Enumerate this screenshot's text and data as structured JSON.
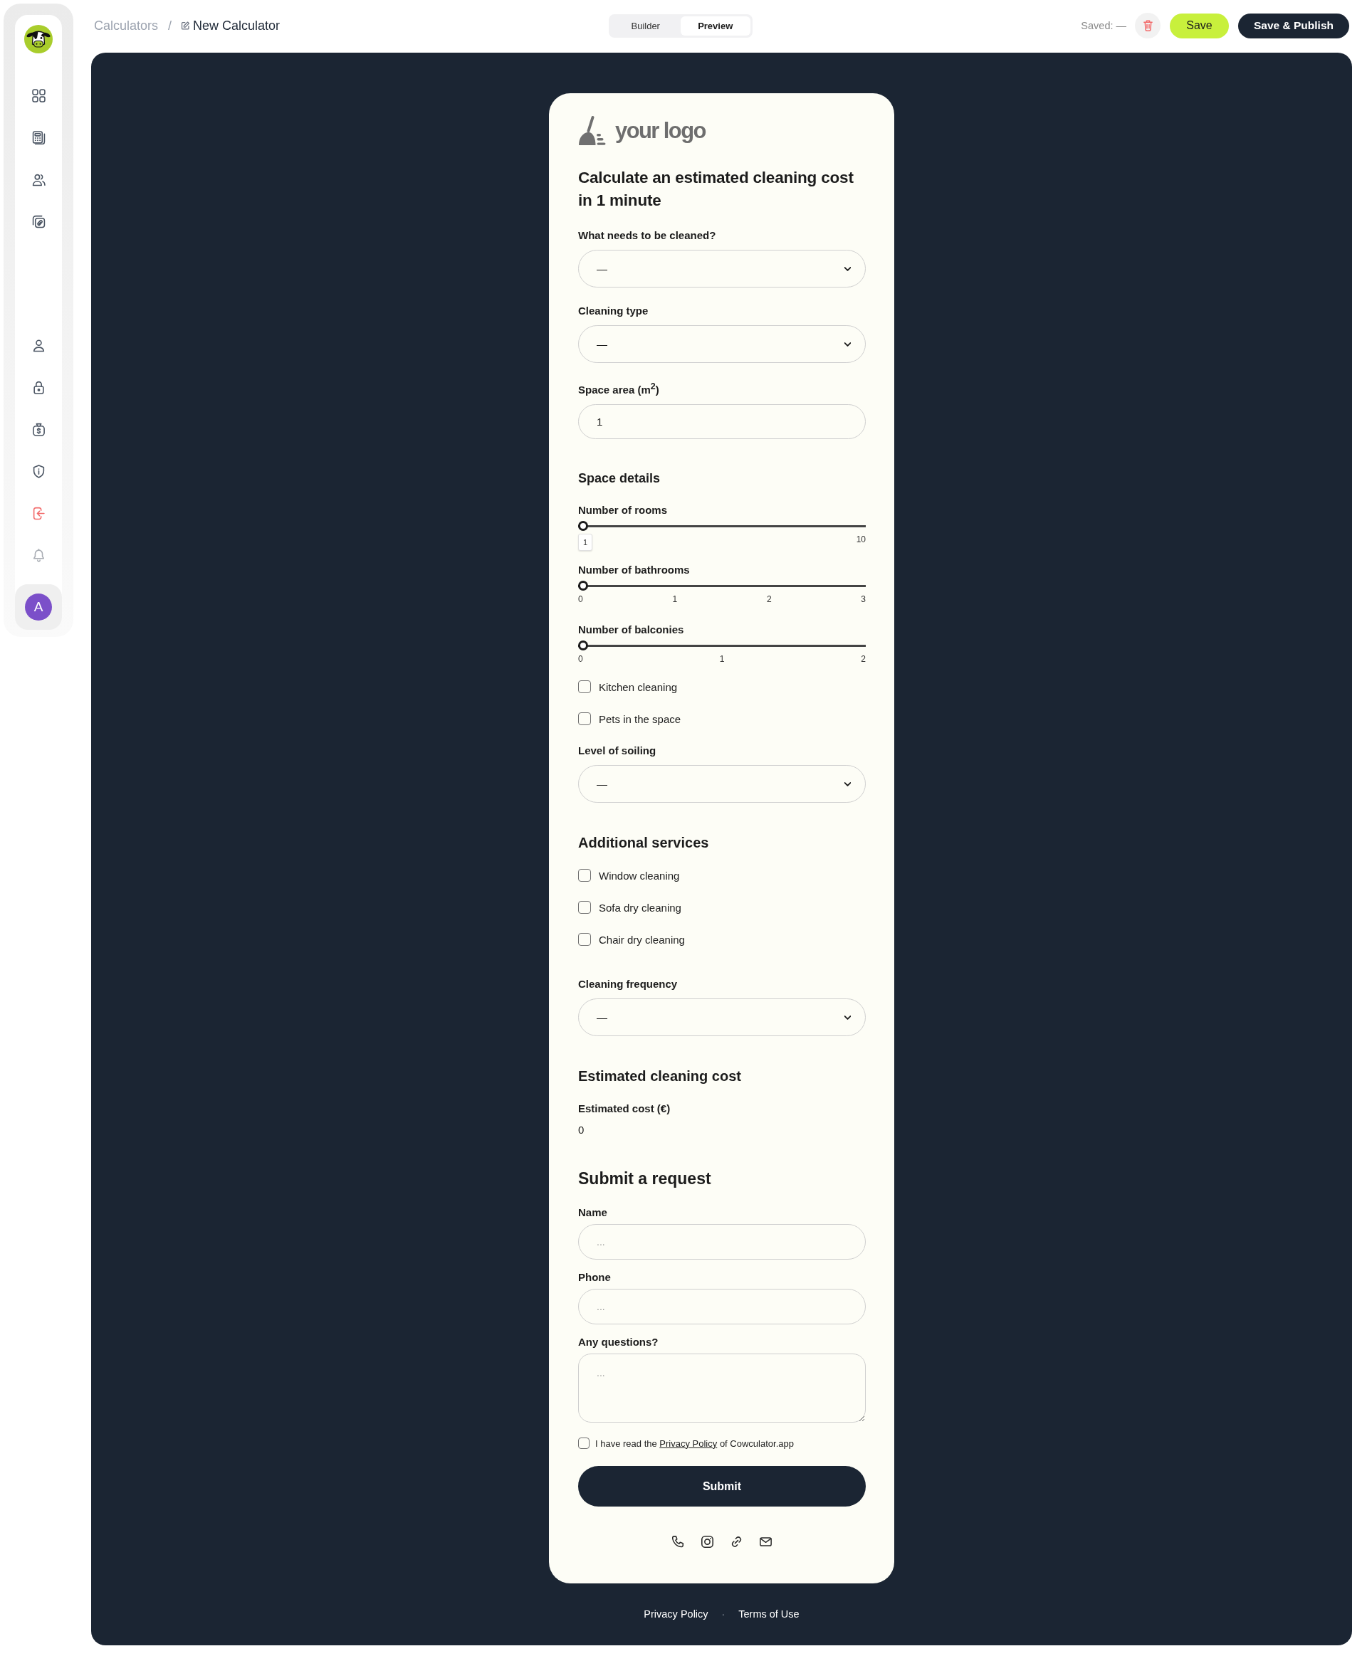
{
  "sidebar": {
    "avatar_initial": "A"
  },
  "breadcrumb": {
    "items": [
      {
        "label": "Calculators",
        "current": false
      },
      {
        "label": "New Calculator",
        "current": true
      }
    ],
    "separator": "/"
  },
  "mode_toggle": [
    {
      "label": "Builder",
      "selected": false
    },
    {
      "label": "Preview",
      "selected": true
    }
  ],
  "save_status": "Saved: —",
  "buttons": [
    {
      "kind": "accent",
      "label": "Save"
    },
    {
      "kind": "dark",
      "label": "Save & Publish"
    }
  ],
  "calculator": {
    "logo_text": "your logo",
    "title": "Calculate an estimated cleaning cost in 1 minute",
    "sections": [
      {
        "fields": [
          {
            "kind": "select",
            "label": "What needs to be cleaned?",
            "value": "—"
          },
          {
            "kind": "select",
            "label": "Cleaning type",
            "value": "—"
          },
          {
            "kind": "number",
            "label": "Space area (m$^{2}$)",
            "value": "1"
          }
        ]
      },
      {
        "heading": {
          "kind": "group",
          "text": "Space details"
        },
        "fields": [
          {
            "kind": "slider",
            "label": "Number of rooms",
            "level": 0,
            "value_bubble": "1",
            "ticks": [
              "10"
            ]
          },
          {
            "kind": "slider",
            "label": "Number of bathrooms",
            "level": 0,
            "ticks": [
              "0",
              "1",
              "2",
              "3"
            ]
          },
          {
            "kind": "slider",
            "label": "Number of balconies",
            "level": 0,
            "ticks": [
              "0",
              "1",
              "2"
            ]
          },
          {
            "kind": "checkbox",
            "label": "Kitchen cleaning",
            "checked": false
          },
          {
            "kind": "checkbox",
            "label": "Pets in the space",
            "checked": false
          },
          {
            "kind": "select",
            "label": "Level of soiling",
            "value": "—"
          }
        ]
      },
      {
        "heading": {
          "kind": "section",
          "text": "Additional services"
        },
        "fields": [
          {
            "kind": "checkbox",
            "label": "Window cleaning",
            "checked": false
          },
          {
            "kind": "checkbox",
            "label": "Sofa dry cleaning",
            "checked": false
          },
          {
            "kind": "checkbox",
            "label": "Chair dry cleaning",
            "checked": false
          }
        ]
      },
      {
        "fields": [
          {
            "kind": "select",
            "label": "Cleaning frequency",
            "value": "—"
          }
        ]
      },
      {
        "heading": {
          "kind": "section",
          "text": "Estimated cleaning cost"
        },
        "fields": [
          {
            "kind": "output",
            "label": "Estimated cost (€)",
            "value": "0"
          }
        ]
      },
      {
        "heading": {
          "kind": "request",
          "text": "Submit a request"
        },
        "fields": [
          {
            "kind": "text",
            "label": "Name",
            "placeholder": "..."
          },
          {
            "kind": "text",
            "label": "Phone",
            "placeholder": "..."
          },
          {
            "kind": "textarea",
            "label": "Any questions?",
            "placeholder": "..."
          },
          {
            "kind": "consent",
            "checked": false,
            "text_before": "I have read the",
            "link": "Privacy Policy",
            "text_after": "of Cowculator.app"
          },
          {
            "kind": "submit",
            "label": "Submit"
          }
        ]
      }
    ]
  },
  "footer": {
    "links": [
      "Privacy Policy",
      "Terms of Use"
    ],
    "separator": "·"
  }
}
